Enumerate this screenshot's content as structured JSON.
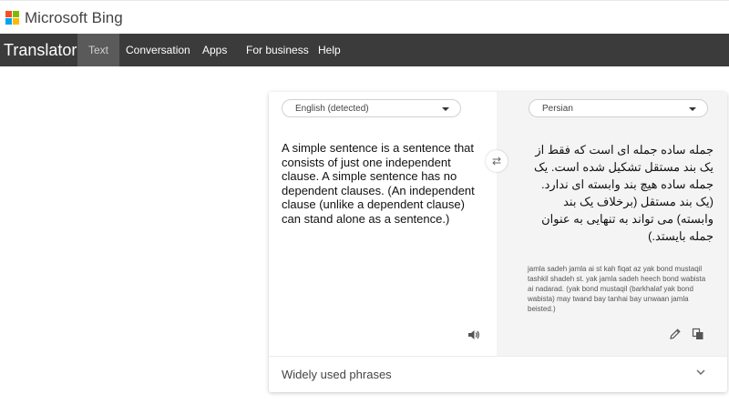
{
  "brand": {
    "name": "Microsoft Bing"
  },
  "nav": {
    "title": "Translator",
    "items": [
      {
        "label": "Text",
        "active": true
      },
      {
        "label": "Conversation",
        "active": false
      },
      {
        "label": "Apps",
        "active": false
      },
      {
        "label": "For business",
        "active": false
      },
      {
        "label": "Help",
        "active": false
      }
    ]
  },
  "translator": {
    "source_lang": "English (detected)",
    "target_lang": "Persian",
    "source_text": "A simple sentence is a sentence that consists of just one independent clause. A simple sentence has no dependent clauses. (An independent clause (unlike a dependent clause) can stand alone as a sentence.)",
    "target_text": "جمله ساده جمله ای است که فقط از یک بند مستقل تشکیل شده است. یک جمله ساده هیچ بند وابسته ای ندارد. (یک بند مستقل (برخلاف یک بند وابسته) می تواند به تنهایی به عنوان جمله بایستد.)",
    "transliteration": "jamla sadeh jamla ai st kah fiqat az yak bond mustaqil tashkil shadeh st. yak jamla sadeh heech bond wabista ai nadarad. (yak bond mustaqil (barkhalaf yak bond wabista) may twand bay tanhai bay unwaan jamla beisted.)"
  },
  "phrases": {
    "label": "Widely used phrases"
  },
  "icons": {
    "logo": "microsoft-logo",
    "swap": "swap-arrows-icon",
    "speaker": "speaker-icon",
    "edit": "pencil-icon",
    "copy": "copy-icon",
    "chevron": "chevron-down-icon"
  },
  "colors": {
    "navbar": "#3b3b3b",
    "nav_active": "#5a5a5a",
    "logo_red": "#f25022",
    "logo_green": "#7fba00",
    "logo_blue": "#00a4ef",
    "logo_yellow": "#ffb900"
  }
}
